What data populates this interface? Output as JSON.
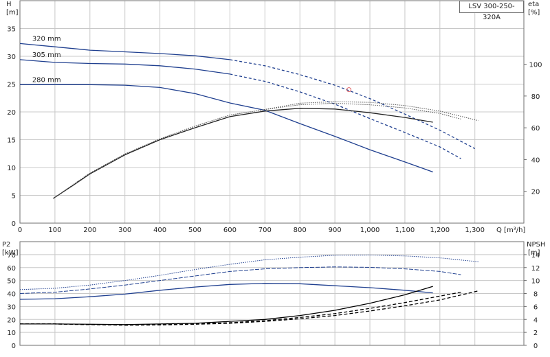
{
  "chart_data": [
    {
      "type": "line",
      "title": "LSV 300-250-320A",
      "x_axis": {
        "label": "Q [m³/h]",
        "range": [
          0,
          1440
        ],
        "ticks": [
          0,
          100,
          200,
          300,
          400,
          500,
          600,
          700,
          800,
          900,
          1000,
          1100,
          1200,
          1300
        ],
        "tick_labels": [
          "0",
          "100",
          "200",
          "300",
          "400",
          "500",
          "600",
          "700",
          "800",
          "900",
          "1,000",
          "1,100",
          "1,200",
          "1,300"
        ]
      },
      "y_left": {
        "label": "H",
        "unit": "[m]",
        "range": [
          0,
          40
        ],
        "ticks": [
          0,
          5,
          10,
          15,
          20,
          25,
          30,
          35
        ],
        "tick_labels": [
          "0",
          "5",
          "10",
          "15",
          "20",
          "25",
          "30",
          "35"
        ]
      },
      "y_right": {
        "label": "eta",
        "unit": "[%]",
        "range": [
          0,
          140
        ],
        "ticks": [
          20,
          40,
          60,
          80,
          100
        ],
        "tick_labels": [
          "20",
          "40",
          "60",
          "80",
          "100"
        ]
      },
      "grid": true,
      "series": [
        {
          "name": "320 mm",
          "axis": "left",
          "color": "#1f3f8f",
          "points": [
            [
              0,
              32.3
            ],
            [
              100,
              31.7
            ],
            [
              200,
              31.1
            ],
            [
              300,
              30.8
            ],
            [
              400,
              30.5
            ],
            [
              500,
              30.1
            ],
            [
              600,
              29.4
            ],
            [
              700,
              28.3
            ],
            [
              800,
              26.7
            ],
            [
              900,
              24.8
            ],
            [
              1000,
              22.4
            ],
            [
              1100,
              19.6
            ],
            [
              1200,
              16.7
            ],
            [
              1300,
              13.4
            ]
          ],
          "dashed_from_x": 600
        },
        {
          "name": "305 mm",
          "axis": "left",
          "color": "#1f3f8f",
          "points": [
            [
              0,
              29.4
            ],
            [
              100,
              28.9
            ],
            [
              200,
              28.7
            ],
            [
              300,
              28.6
            ],
            [
              400,
              28.3
            ],
            [
              500,
              27.7
            ],
            [
              600,
              26.8
            ],
            [
              700,
              25.5
            ],
            [
              800,
              23.6
            ],
            [
              900,
              21.4
            ],
            [
              1000,
              18.8
            ],
            [
              1100,
              16.3
            ],
            [
              1200,
              13.7
            ],
            [
              1260,
              11.6
            ]
          ],
          "dashed_from_x": 650
        },
        {
          "name": "280 mm",
          "axis": "left",
          "color": "#1f3f8f",
          "points": [
            [
              0,
              24.9
            ],
            [
              100,
              24.9
            ],
            [
              200,
              24.9
            ],
            [
              300,
              24.8
            ],
            [
              400,
              24.4
            ],
            [
              500,
              23.3
            ],
            [
              600,
              21.6
            ],
            [
              700,
              20.3
            ],
            [
              800,
              17.9
            ],
            [
              900,
              15.6
            ],
            [
              1000,
              13.2
            ],
            [
              1100,
              11.0
            ],
            [
              1180,
              9.2
            ]
          ]
        },
        {
          "axis": "right",
          "style": "solid",
          "color": "#222222",
          "points": [
            [
              95,
              15.5
            ],
            [
              150,
              23.5
            ],
            [
              200,
              31
            ],
            [
              300,
              43
            ],
            [
              400,
              52.5
            ],
            [
              500,
              60
            ],
            [
              600,
              67
            ],
            [
              700,
              70.5
            ],
            [
              800,
              72.3
            ],
            [
              900,
              71.8
            ],
            [
              1000,
              69.5
            ],
            [
              1100,
              66.5
            ],
            [
              1180,
              63.5
            ]
          ]
        },
        {
          "axis": "right",
          "style": "dotted",
          "color": "#555555",
          "points": [
            [
              95,
              15.5
            ],
            [
              200,
              31.5
            ],
            [
              300,
              43.5
            ],
            [
              400,
              53
            ],
            [
              500,
              61
            ],
            [
              600,
              68
            ],
            [
              700,
              71.5
            ],
            [
              800,
              74.5
            ],
            [
              900,
              75.5
            ],
            [
              1000,
              74.5
            ],
            [
              1100,
              72.5
            ],
            [
              1200,
              69
            ],
            [
              1260,
              65.5
            ]
          ]
        },
        {
          "axis": "right",
          "style": "dotted",
          "color": "#555555",
          "points": [
            [
              95,
              15.5
            ],
            [
              200,
              31.5
            ],
            [
              300,
              43.5
            ],
            [
              400,
              53
            ],
            [
              500,
              61
            ],
            [
              600,
              68
            ],
            [
              700,
              71.5
            ],
            [
              800,
              75.5
            ],
            [
              900,
              76.5
            ],
            [
              1000,
              76
            ],
            [
              1100,
              74
            ],
            [
              1200,
              70.5
            ],
            [
              1310,
              64.5
            ]
          ]
        }
      ],
      "annotations": [
        {
          "type": "point-marker",
          "x": 940,
          "y": 24.0,
          "color": "#e06060"
        }
      ]
    },
    {
      "type": "line",
      "x_axis": {
        "label": "",
        "range": [
          0,
          1440
        ],
        "ticks": [
          0,
          100,
          200,
          300,
          400,
          500,
          600,
          700,
          800,
          900,
          1000,
          1100,
          1200,
          1300
        ]
      },
      "y_left": {
        "label": "P2",
        "unit": "[kW]",
        "range": [
          0,
          80
        ],
        "ticks": [
          0,
          10,
          20,
          30,
          40,
          50,
          60,
          70
        ],
        "tick_labels": [
          "0",
          "10",
          "20",
          "30",
          "40",
          "50",
          "60",
          "70"
        ]
      },
      "y_right": {
        "label": "NPSH",
        "unit": "[m]",
        "range": [
          0,
          16
        ],
        "ticks": [
          0,
          2,
          4,
          6,
          8,
          10,
          12,
          14
        ],
        "tick_labels": [
          "0",
          "2",
          "4",
          "6",
          "8",
          "10",
          "12",
          "14"
        ]
      },
      "grid": true,
      "series": [
        {
          "axis": "left",
          "style": "dotted-outer",
          "color": "#1f3f8f",
          "points": [
            [
              0,
              43
            ],
            [
              100,
              44
            ],
            [
              200,
              46.5
            ],
            [
              300,
              50
            ],
            [
              400,
              54
            ],
            [
              500,
              58.5
            ],
            [
              600,
              62.5
            ],
            [
              700,
              66
            ],
            [
              800,
              68
            ],
            [
              900,
              69.5
            ],
            [
              1000,
              69.7
            ],
            [
              1100,
              69
            ],
            [
              1200,
              67.5
            ],
            [
              1310,
              64.5
            ]
          ]
        },
        {
          "axis": "left",
          "style": "mixed",
          "color": "#1f3f8f",
          "points": [
            [
              0,
              40
            ],
            [
              100,
              41
            ],
            [
              200,
              43.5
            ],
            [
              300,
              46.5
            ],
            [
              400,
              50
            ],
            [
              500,
              53.5
            ],
            [
              600,
              57
            ],
            [
              700,
              59
            ],
            [
              800,
              60
            ],
            [
              900,
              60.5
            ],
            [
              1000,
              60.2
            ],
            [
              1100,
              59
            ],
            [
              1200,
              57
            ],
            [
              1260,
              54.5
            ]
          ]
        },
        {
          "axis": "left",
          "style": "solid",
          "color": "#1f3f8f",
          "points": [
            [
              0,
              35.5
            ],
            [
              100,
              36
            ],
            [
              200,
              37.5
            ],
            [
              300,
              39.5
            ],
            [
              400,
              42.5
            ],
            [
              500,
              45
            ],
            [
              600,
              47
            ],
            [
              700,
              47.8
            ],
            [
              800,
              47.5
            ],
            [
              900,
              46
            ],
            [
              1000,
              44.5
            ],
            [
              1100,
              42.5
            ],
            [
              1180,
              40.5
            ]
          ]
        },
        {
          "axis": "right",
          "style": "solid",
          "color": "#000000",
          "points": [
            [
              0,
              3.3
            ],
            [
              100,
              3.3
            ],
            [
              200,
              3.25
            ],
            [
              300,
              3.2
            ],
            [
              400,
              3.3
            ],
            [
              500,
              3.4
            ],
            [
              600,
              3.7
            ],
            [
              700,
              4.0
            ],
            [
              800,
              4.6
            ],
            [
              900,
              5.4
            ],
            [
              1000,
              6.5
            ],
            [
              1100,
              7.8
            ],
            [
              1180,
              9.1
            ]
          ]
        },
        {
          "axis": "right",
          "style": "dashed",
          "color": "#000000",
          "points": [
            [
              0,
              3.3
            ],
            [
              100,
              3.3
            ],
            [
              200,
              3.2
            ],
            [
              300,
              3.15
            ],
            [
              400,
              3.2
            ],
            [
              500,
              3.3
            ],
            [
              600,
              3.5
            ],
            [
              700,
              3.8
            ],
            [
              800,
              4.3
            ],
            [
              900,
              4.9
            ],
            [
              1000,
              5.7
            ],
            [
              1100,
              6.6
            ],
            [
              1200,
              7.6
            ],
            [
              1260,
              8.2
            ]
          ]
        },
        {
          "axis": "right",
          "style": "dashed",
          "color": "#000000",
          "points": [
            [
              0,
              3.3
            ],
            [
              100,
              3.3
            ],
            [
              200,
              3.2
            ],
            [
              300,
              3.1
            ],
            [
              400,
              3.15
            ],
            [
              500,
              3.25
            ],
            [
              600,
              3.4
            ],
            [
              700,
              3.7
            ],
            [
              800,
              4.1
            ],
            [
              900,
              4.6
            ],
            [
              1000,
              5.3
            ],
            [
              1100,
              6.1
            ],
            [
              1200,
              7.0
            ],
            [
              1310,
              8.4
            ]
          ]
        }
      ]
    }
  ]
}
